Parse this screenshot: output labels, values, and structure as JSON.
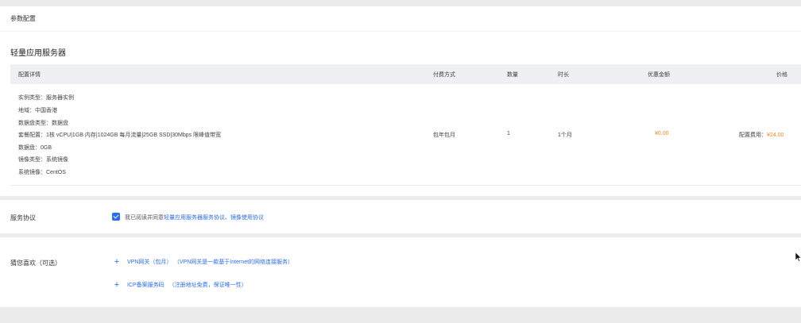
{
  "section": {
    "title": "参数配置"
  },
  "product": {
    "title": "轻量应用服务器"
  },
  "table": {
    "headers": {
      "detail": "配置详情",
      "billing": "付费方式",
      "quantity": "数量",
      "duration": "时长",
      "discount": "优惠金额",
      "price": "价格"
    },
    "details": [
      "实例类型：服务器实例",
      "地域：中国香港",
      "数据盘类型：数据盘",
      "套餐配置：1核 vCPU|1GB 内存|1024GB 每月流量|25GB SSD|30Mbps 限峰值带宽",
      "数据盘：0GB",
      "镜像类型：系统镜像",
      "系统镜像：CentOS"
    ],
    "row": {
      "billing": "包年包月",
      "quantity": "1",
      "duration": "1个月",
      "discount": "¥0.00",
      "price_label": "配置费用：",
      "price_value": "¥24.00"
    }
  },
  "agreement": {
    "label": "服务协议",
    "checked": true,
    "text_prefix": "我已阅读并同意",
    "link_text": "轻量应用服务器服务协议、镜像使用协议"
  },
  "recommend": {
    "label": "猜您喜欢（可选）",
    "items": [
      {
        "name": "VPN网关（包月）",
        "desc": "（VPN网关是一款基于Internet的网络连接服务）"
      },
      {
        "name": "ICP备案服务码",
        "desc": "（注册地址免费，保证唯一性）"
      }
    ]
  },
  "colors": {
    "accent": "#2a6de8",
    "price": "#f08a24",
    "page_bg": "#ececec",
    "table_head_bg": "#eef0f3"
  }
}
